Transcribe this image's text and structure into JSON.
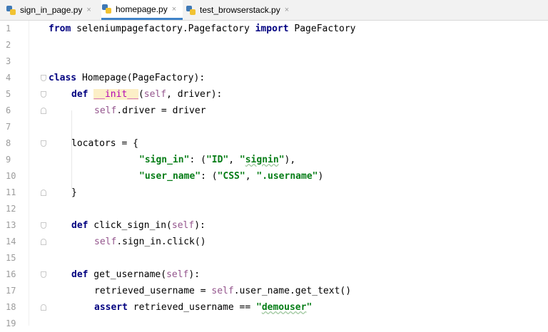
{
  "tabs": [
    {
      "label": "sign_in_page.py",
      "close": "×",
      "active": false
    },
    {
      "label": "homepage.py",
      "close": "×",
      "active": true
    },
    {
      "label": "test_browserstack.py",
      "close": "×",
      "active": false
    }
  ],
  "line_numbers": [
    "1",
    "2",
    "3",
    "4",
    "5",
    "6",
    "7",
    "8",
    "9",
    "10",
    "11",
    "12",
    "13",
    "14",
    "15",
    "16",
    "17",
    "18",
    "19"
  ],
  "code": {
    "l1": {
      "kw1": "from",
      "mod": " seleniumpagefactory.Pagefactory ",
      "kw2": "import",
      "name": " PageFactory"
    },
    "l4": {
      "kw": "class",
      "rest": " Homepage(PageFactory):"
    },
    "l5": {
      "kw": "def",
      "sp": " ",
      "magic": "__init__",
      "p1": "(",
      "self": "self",
      "p2": ", driver):"
    },
    "l6": {
      "self": "self",
      "rest": ".driver = driver"
    },
    "l8": {
      "text": "locators = {"
    },
    "l9": {
      "s1": "\"sign_in\"",
      "p1": ": (",
      "s2": "\"ID\"",
      "p2": ", ",
      "s3a": "\"",
      "s3b": "signin",
      "s3c": "\"",
      "p3": "),"
    },
    "l10": {
      "s1": "\"user_name\"",
      "p1": ": (",
      "s2": "\"CSS\"",
      "p2": ", ",
      "s3": "\".username\"",
      "p3": ")"
    },
    "l11": {
      "text": "}"
    },
    "l13": {
      "kw": "def",
      "name": " click_sign_in(",
      "self": "self",
      "end": "):"
    },
    "l14": {
      "self": "self",
      "rest": ".sign_in.click()"
    },
    "l16": {
      "kw": "def",
      "name": " get_username(",
      "self": "self",
      "end": "):"
    },
    "l17": {
      "pre": "retrieved_username = ",
      "self": "self",
      "rest": ".user_name.get_text()"
    },
    "l18": {
      "kw": "assert",
      "mid": " retrieved_username == ",
      "s1": "\"",
      "s2": "demouser",
      "s3": "\""
    }
  },
  "colors": {
    "keyword": "#000080",
    "string": "#067d17",
    "self": "#94558d",
    "magic": "#b200b2",
    "line_number": "#9b9b9b",
    "active_tab_underline": "#4083c9"
  },
  "icons": {
    "tab_file": "python-file-icon",
    "fold": "fold-marker-icon"
  }
}
